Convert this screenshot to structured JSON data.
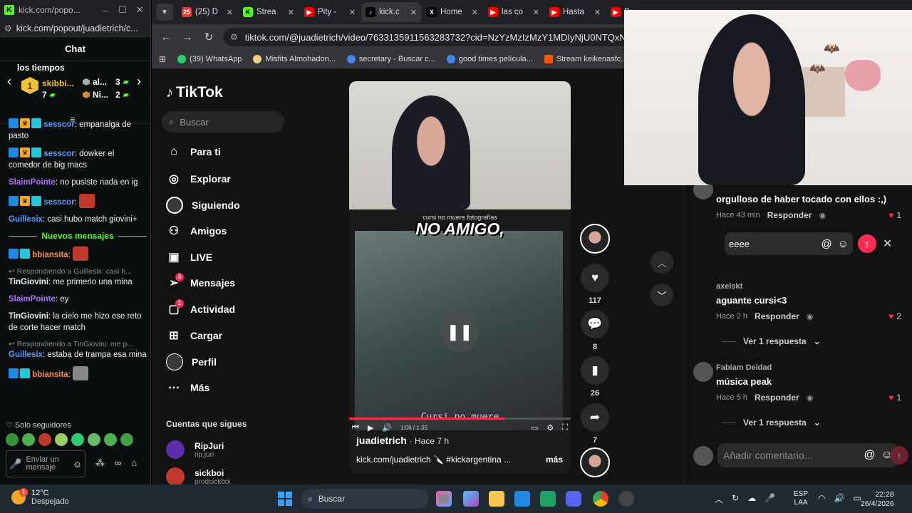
{
  "kick": {
    "title": "kick.com/popo...",
    "url": "kick.com/popout/juadietrich/c...",
    "chat_header": "Chat",
    "leaderboard": {
      "subtitle": "los tiempos",
      "first": {
        "rank": "1",
        "name": "skibbi...",
        "count": "7"
      },
      "second": {
        "name": "al...",
        "count": "3"
      },
      "third": {
        "name": "Ni...",
        "count": "2"
      }
    },
    "messages": [
      {
        "user": "sesscor",
        "color": "#5b9bff",
        "text": ": empanalga de pasto"
      },
      {
        "user": "sesscor",
        "color": "#5b9bff",
        "text": ": dowker el comedor de big macs"
      },
      {
        "user": "SlaimPointe",
        "color": "#b06cff",
        "text": ": no pusiste nada en ig"
      },
      {
        "user": "sesscor",
        "color": "#5b9bff",
        "text": ":"
      },
      {
        "user": "Guillesix",
        "color": "#5b9bff",
        "text": ": casi hubo match giovini+"
      }
    ],
    "new_messages_label": "Nuevos mensajes",
    "messages_after": [
      {
        "user": "bbiansita",
        "color": "#ff8a3d",
        "text": ":"
      },
      {
        "reply": "Respondiendo a Guillesix: casi h..."
      },
      {
        "user": "TinGiovini",
        "color": "#ffffff",
        "text": ": me primerio una mina"
      },
      {
        "user": "SlaimPointe",
        "color": "#b06cff",
        "text": ": ey"
      },
      {
        "user": "TinGiovini",
        "color": "#ffffff",
        "text": ": la cielo me hizo ese reto de corte hacer match"
      },
      {
        "reply": "Respondiendo a TinGiovini: me p..."
      },
      {
        "user": "Guillesix",
        "color": "#5b9bff",
        "text": ": estaba de trampa esa mina"
      },
      {
        "user": "bbiansita",
        "color": "#ff8a3d",
        "text": ":"
      }
    ],
    "followers_only": "Solo seguidores",
    "input_placeholder": "Enviar un mensaje"
  },
  "chrome": {
    "tabs": [
      {
        "label": "(25) D",
        "color": "#e53935",
        "icon": "25"
      },
      {
        "label": "Strea",
        "color": "#53fc18",
        "icon": "K"
      },
      {
        "label": "Pity -",
        "color": "#ff0000",
        "icon": "▶"
      },
      {
        "label": "kick.c",
        "color": "#000000",
        "icon": "♪",
        "active": true
      },
      {
        "label": "Home",
        "color": "#000000",
        "icon": "X"
      },
      {
        "label": "las co",
        "color": "#ff0000",
        "icon": "▶"
      },
      {
        "label": "Hasta",
        "color": "#ff0000",
        "icon": "▶"
      },
      {
        "label": "Po",
        "color": "#ff0000",
        "icon": "▶"
      }
    ],
    "url": "tiktok.com/@juadietrich/video/7633135911563283732?cid=NzYzMzIzMzY1MDIyNjU0NTQxNg",
    "bookmarks": [
      {
        "label": "(39) WhatsApp",
        "color": "#25d366"
      },
      {
        "label": "Misfits Almohadon...",
        "color": "#f0d080"
      },
      {
        "label": "secretary - Buscar c...",
        "color": "#4285f4"
      },
      {
        "label": "good times película...",
        "color": "#4285f4"
      },
      {
        "label": "Stream keikenasfc...",
        "color": "#ff5500"
      }
    ]
  },
  "tiktok": {
    "logo": "TikTok",
    "search_placeholder": "Buscar",
    "nav": [
      {
        "label": "Para ti",
        "icon": "⌂"
      },
      {
        "label": "Explorar",
        "icon": "◎"
      },
      {
        "label": "Siguiendo",
        "icon": "avatar"
      },
      {
        "label": "Amigos",
        "icon": "👥"
      },
      {
        "label": "LIVE",
        "icon": "▣"
      },
      {
        "label": "Mensajes",
        "icon": "✈",
        "badge": "3"
      },
      {
        "label": "Actividad",
        "icon": "▢",
        "badge": "1"
      },
      {
        "label": "Cargar",
        "icon": "⊞"
      },
      {
        "label": "Perfil",
        "icon": "avatar"
      },
      {
        "label": "Más",
        "icon": "⋯"
      }
    ],
    "following_header": "Cuentas que sigues",
    "following": [
      {
        "name": "RipJuri",
        "handle": "rip.juri",
        "color": "#5b2da8"
      },
      {
        "name": "sickboi",
        "handle": "prodsickboi",
        "color": "#c0392b"
      }
    ],
    "video": {
      "caption_small": "cursi no muere fotografías",
      "overlay_text": "NO AMIGO,",
      "overlay_title": "Cursi no muere",
      "time": "1:06 / 1:35",
      "author": "juadietrich",
      "ago": "· Hace 7 h",
      "desc": "kick.com/juadietrich 🔪 #kickargentina ...",
      "more": "más",
      "progress": 0.7
    },
    "actions": {
      "likes": "117",
      "comments": "8",
      "saves": "26",
      "shares": "7"
    },
    "comments": [
      {
        "text": "orgulloso de haber tocado con ellos :,)",
        "time": "Hace 43 min",
        "reply": "Responder",
        "likes": "1"
      },
      {
        "user": "axelskt",
        "text": "aguante cursi<3",
        "time": "Hace 2 h",
        "reply": "Responder",
        "likes": "2",
        "view": "Ver 1 respuesta"
      },
      {
        "user": "Fabiam Deidad",
        "text": "música peak",
        "time": "Hace 5 h",
        "reply": "Responder",
        "likes": "1",
        "view": "Ver 1 respuesta"
      }
    ],
    "reply_value": "eeee",
    "add_comment_placeholder": "Añadir comentario..."
  },
  "taskbar": {
    "temp": "12°C",
    "weather": "Despejado",
    "badge": "1",
    "search": "Buscar",
    "lang1": "ESP",
    "lang2": "LAA",
    "time": "22:28",
    "date": "26/4/2026"
  }
}
